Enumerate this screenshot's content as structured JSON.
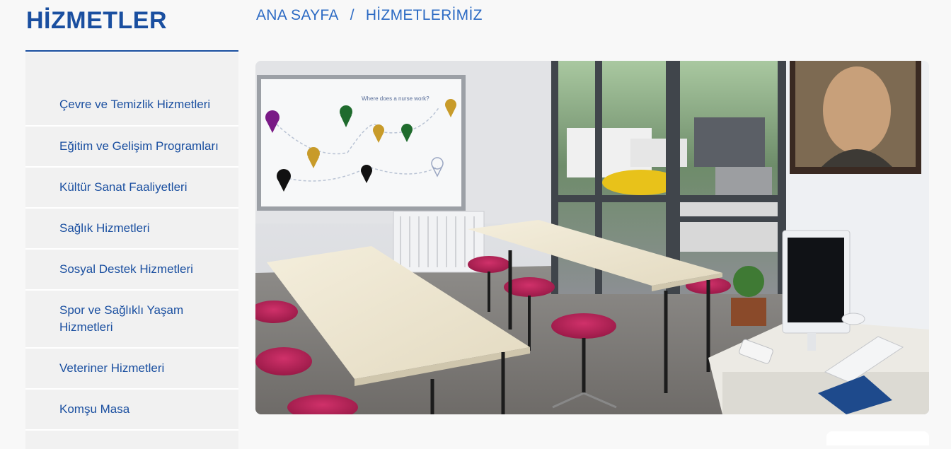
{
  "sidebar": {
    "title": "HİZMETLER",
    "items": [
      {
        "label": "Çevre ve Temizlik Hizmetleri"
      },
      {
        "label": "Eğitim ve Gelişim Programları"
      },
      {
        "label": "Kültür Sanat Faaliyetleri"
      },
      {
        "label": "Sağlık Hizmetleri"
      },
      {
        "label": "Sosyal Destek Hizmetleri"
      },
      {
        "label": "Spor ve Sağlıklı Yaşam Hizmetleri"
      },
      {
        "label": "Veteriner Hizmetleri"
      },
      {
        "label": "Komşu Masa"
      }
    ]
  },
  "breadcrumb": {
    "home": "ANA SAYFA",
    "separator": "/",
    "current": "HİZMETLERİMİZ"
  },
  "hero": {
    "whiteboard_text": "Where does a nurse work?"
  },
  "colors": {
    "accent": "#1a4fa0",
    "breadcrumb": "#2d6bc4",
    "menu_bg": "#f1f1f1"
  }
}
